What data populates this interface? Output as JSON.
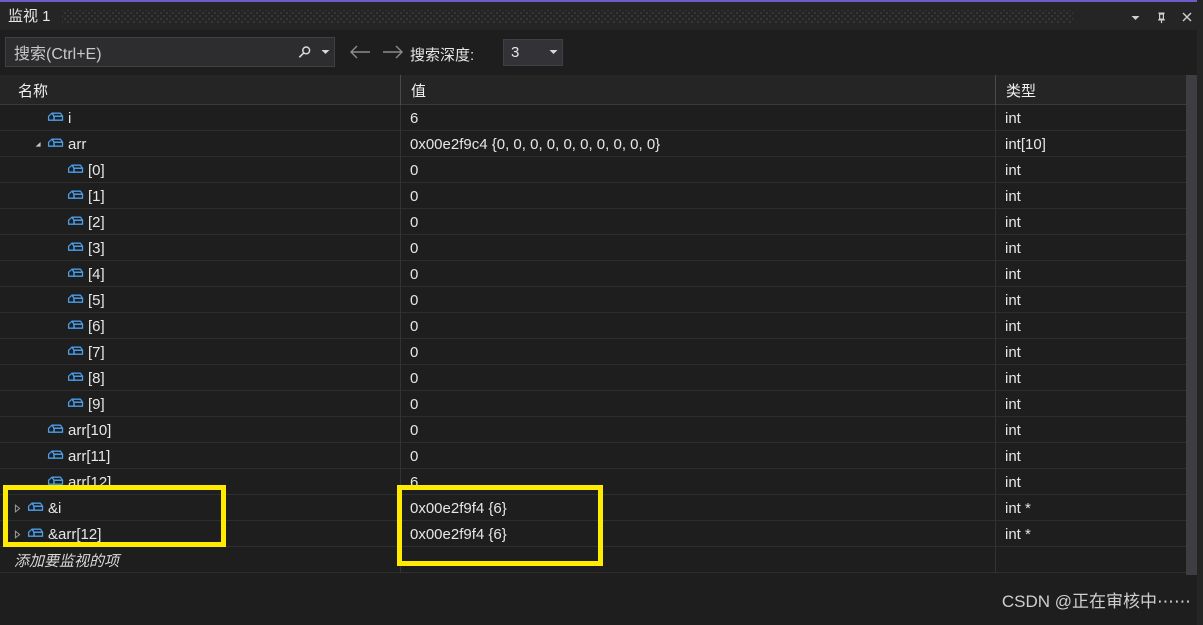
{
  "window": {
    "title": "监视 1",
    "buttons": [
      {
        "name": "dropdown-button",
        "glyph": "chevron-down-icon"
      },
      {
        "name": "pin-button",
        "glyph": "pin-icon"
      },
      {
        "name": "close-button",
        "glyph": "close-icon"
      }
    ]
  },
  "toolbar": {
    "search_placeholder": "搜索(Ctrl+E)",
    "search_value": "",
    "search_icon": "search-icon",
    "search_dropdown_icon": "chevron-down-icon",
    "nav_back_icon": "arrow-left-icon",
    "nav_forward_icon": "arrow-right-icon",
    "depth_label": "搜索深度:",
    "depth_value": "3",
    "depth_dropdown_icon": "chevron-down-icon"
  },
  "grid": {
    "columns": [
      {
        "key": "name",
        "label": "名称"
      },
      {
        "key": "value",
        "label": "值"
      },
      {
        "key": "type",
        "label": "类型"
      }
    ],
    "add_item_placeholder": "添加要监视的项",
    "rows": [
      {
        "name": "i",
        "value": "6",
        "type": "int",
        "indent": 1,
        "expander": "none",
        "icon": "variable-box-icon"
      },
      {
        "name": "arr",
        "value": "0x00e2f9c4 {0, 0, 0, 0, 0, 0, 0, 0, 0, 0}",
        "type": "int[10]",
        "indent": 1,
        "expander": "expanded",
        "icon": "variable-box-icon"
      },
      {
        "name": "[0]",
        "value": "0",
        "type": "int",
        "indent": 2,
        "expander": "none",
        "icon": "variable-box-icon"
      },
      {
        "name": "[1]",
        "value": "0",
        "type": "int",
        "indent": 2,
        "expander": "none",
        "icon": "variable-box-icon"
      },
      {
        "name": "[2]",
        "value": "0",
        "type": "int",
        "indent": 2,
        "expander": "none",
        "icon": "variable-box-icon"
      },
      {
        "name": "[3]",
        "value": "0",
        "type": "int",
        "indent": 2,
        "expander": "none",
        "icon": "variable-box-icon"
      },
      {
        "name": "[4]",
        "value": "0",
        "type": "int",
        "indent": 2,
        "expander": "none",
        "icon": "variable-box-icon"
      },
      {
        "name": "[5]",
        "value": "0",
        "type": "int",
        "indent": 2,
        "expander": "none",
        "icon": "variable-box-icon"
      },
      {
        "name": "[6]",
        "value": "0",
        "type": "int",
        "indent": 2,
        "expander": "none",
        "icon": "variable-box-icon"
      },
      {
        "name": "[7]",
        "value": "0",
        "type": "int",
        "indent": 2,
        "expander": "none",
        "icon": "variable-box-icon"
      },
      {
        "name": "[8]",
        "value": "0",
        "type": "int",
        "indent": 2,
        "expander": "none",
        "icon": "variable-box-icon"
      },
      {
        "name": "[9]",
        "value": "0",
        "type": "int",
        "indent": 2,
        "expander": "none",
        "icon": "variable-box-icon"
      },
      {
        "name": "arr[10]",
        "value": "0",
        "type": "int",
        "indent": 1,
        "expander": "none",
        "icon": "variable-box-icon"
      },
      {
        "name": "arr[11]",
        "value": "0",
        "type": "int",
        "indent": 1,
        "expander": "none",
        "icon": "variable-box-icon"
      },
      {
        "name": "arr[12]",
        "value": "6",
        "type": "int",
        "indent": 1,
        "expander": "none",
        "icon": "variable-box-icon"
      },
      {
        "name": "&i",
        "value": "0x00e2f9f4 {6}",
        "type": "int *",
        "indent": 0,
        "expander": "collapsed",
        "icon": "variable-box-icon"
      },
      {
        "name": "&arr[12]",
        "value": "0x00e2f9f4 {6}",
        "type": "int *",
        "indent": 0,
        "expander": "collapsed",
        "icon": "variable-box-icon"
      }
    ]
  },
  "annotations": {
    "highlight_color": "#ffeb00",
    "boxes": [
      {
        "name": "highlight-box-names",
        "target": "&i / &arr[12] name cells"
      },
      {
        "name": "highlight-box-values",
        "target": "&i / &arr[12] value cells"
      }
    ]
  },
  "footer": {
    "watermark": "CSDN @正在审核中⋯⋯"
  }
}
